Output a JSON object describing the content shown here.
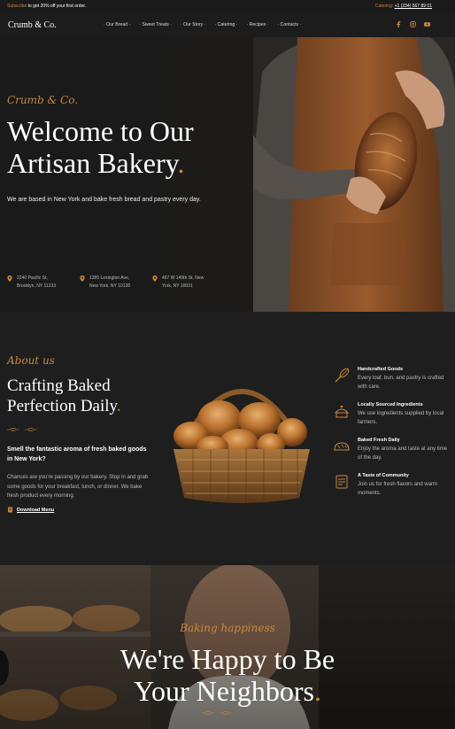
{
  "topbar": {
    "promo_bold": "Subscribe",
    "promo_rest": " to get 20% off your first order.",
    "catering_label": "Catering:",
    "phone": "+1 (234) 567 89 01"
  },
  "nav": {
    "logo": "Crumb & Co.",
    "items": [
      "· Our Bread ·",
      "· Sweet Treats ·",
      "· Our Story ·",
      "· Catering ·",
      "· Recipes ·",
      "· Contacts ·"
    ],
    "social": [
      "facebook-icon",
      "instagram-icon",
      "youtube-icon"
    ]
  },
  "hero": {
    "script": "Crumb & Co.",
    "title_line1": "Welcome to Our",
    "title_line2": "Artisan Bakery",
    "title_dot": ".",
    "lead": "We are based in New York and bake fresh bread and pastry every day.",
    "addresses": [
      {
        "line1": "2240 Pacific St,",
        "line2": "Brooklyn, NY 11233"
      },
      {
        "line1": "1395 Lexington Ave,",
        "line2": "New York, NY 10128"
      },
      {
        "line1": "467 W 149th St, New",
        "line2": "York, NY 10031"
      }
    ]
  },
  "about": {
    "script": "About us",
    "title_line1": "Crafting Baked",
    "title_line2": "Perfection Daily",
    "title_dot": ".",
    "sub": "Smell the fantastic aroma of fresh baked goods in New York?",
    "body": "Chances are you're passing by our bakery. Stop in and grab some goods for your breakfast, lunch, or dinner. We bake fresh product every morning.",
    "download": "Download Menu",
    "features": [
      {
        "icon": "whisk-icon",
        "title": "Handcrafted Goods",
        "desc": "Every loaf, bun, and pastry is crafted with care."
      },
      {
        "icon": "ingredients-icon",
        "title": "Locally Sourced Ingredients",
        "desc": "We use ingredients supplied by local farmers."
      },
      {
        "icon": "bread-icon",
        "title": "Baked Fresh Daily",
        "desc": "Enjoy the aroma and taste at any time of the day."
      },
      {
        "icon": "community-icon",
        "title": "A Taste of Community",
        "desc": "Join us for fresh flavors and warm moments."
      }
    ]
  },
  "neighbors": {
    "script": "Baking happiness",
    "title_line1": "We're Happy to Be",
    "title_line2": "Your Neighbors",
    "title_dot": "."
  },
  "colors": {
    "accent": "#c8853f",
    "dark": "#1c1c1c"
  }
}
